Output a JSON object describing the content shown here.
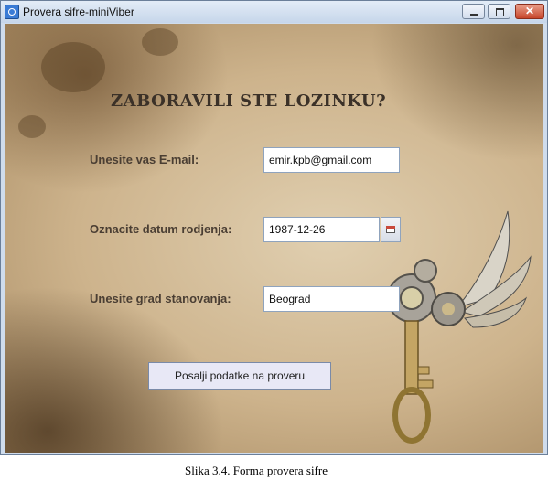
{
  "window": {
    "title": "Provera sifre-miniViber",
    "buttons": {
      "minimize": "minimize",
      "maximize": "maximize",
      "close": "✕"
    }
  },
  "form": {
    "heading": "ZABORAVILI STE LOZINKU?",
    "email_label": "Unesite vas E-mail:",
    "email_value": "emir.kpb@gmail.com",
    "date_label": "Oznacite datum rodjenja:",
    "date_value": "1987-12-26",
    "city_label": "Unesite grad stanovanja:",
    "city_value": "Beograd",
    "submit_label": "Posalji podatke na proveru"
  },
  "caption": "Slika 3.4. Forma provera sifre",
  "icons": [
    "app-icon",
    "calendar-icon",
    "winged-key-illustration"
  ],
  "colors": {
    "titlebar": "#c6d6ea",
    "parchment": "#cdb38c",
    "button_bg": "#e8e8f6"
  }
}
